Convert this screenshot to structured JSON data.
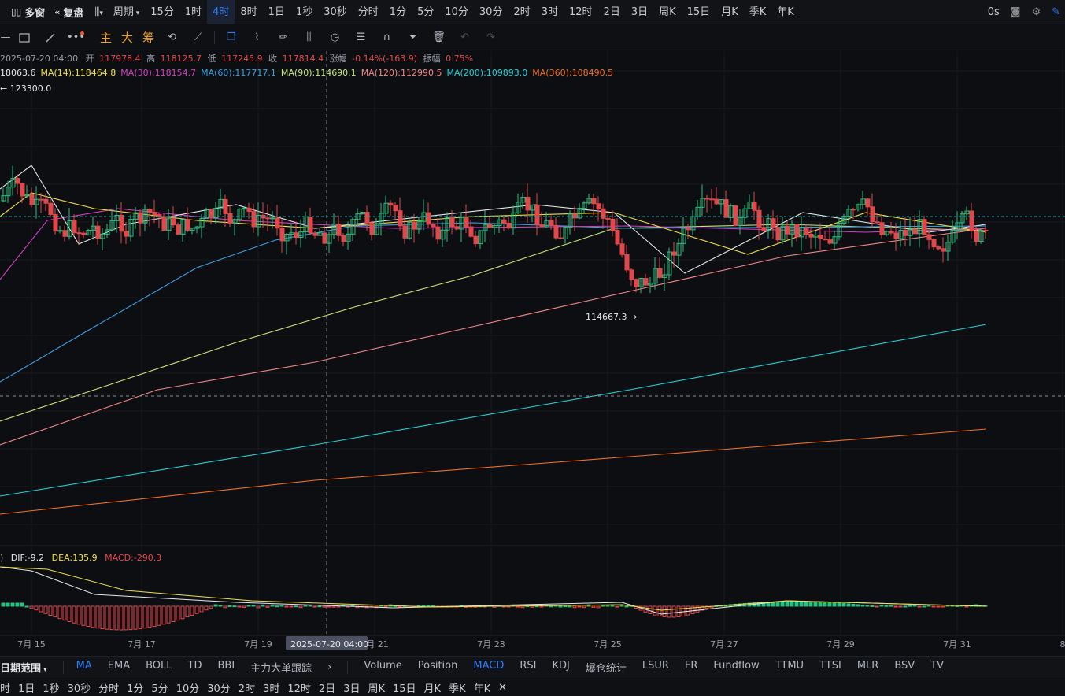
{
  "topbar": {
    "multi_window": "多窗",
    "restore": "复盘",
    "period_label": "周期",
    "intervals": [
      "15分",
      "1时",
      "4时",
      "8时",
      "1日",
      "1秒",
      "30秒",
      "分时",
      "1分",
      "5分",
      "10分",
      "30分",
      "2时",
      "3时",
      "12时",
      "2日",
      "3日",
      "周K",
      "15日",
      "月K",
      "季K",
      "年K"
    ],
    "active_interval": "4时",
    "latency": "0s"
  },
  "toolbar2": {
    "cn_tools": [
      "主",
      "大",
      "筹"
    ]
  },
  "info": {
    "date": "2025-07-20 04:00",
    "open_label": "开",
    "open": "117978.4",
    "high_label": "高",
    "high": "118125.7",
    "low_label": "低",
    "low": "117245.9",
    "close_label": "收",
    "close": "117814.4",
    "change_label": "涨幅",
    "change": "-0.14%(-163.9)",
    "amp_label": "振幅",
    "amp": "0.75%"
  },
  "ma": [
    {
      "label": "18063.6",
      "color": "#e8e8e8"
    },
    {
      "label": "MA(14):118464.8",
      "color": "#f0e040"
    },
    {
      "label": "MA(30):118154.7",
      "color": "#d040c0"
    },
    {
      "label": "MA(60):117717.1",
      "color": "#3aa0e0"
    },
    {
      "label": "MA(90):114690.1",
      "color": "#c8e878"
    },
    {
      "label": "MA(120):112990.5",
      "color": "#f08888"
    },
    {
      "label": "MA(200):109893.0",
      "color": "#20d0d8"
    },
    {
      "label": "MA(360):108490.5",
      "color": "#f07020"
    }
  ],
  "annotations": {
    "high_mark": "← 123300.0",
    "low_mark": "114667.3 →"
  },
  "macd": {
    "prefix": ")",
    "dif": "DIF:-9.2",
    "dea": "DEA:135.9",
    "macd": "MACD:-290.3"
  },
  "xaxis": {
    "labels": [
      "7月 15",
      "7月 17",
      "7月 19",
      "7月 21",
      "7月 23",
      "7月 25",
      "7月 27",
      "7月 29",
      "7月 31",
      "8"
    ],
    "crosshair_label": "2025-07-20 04:00"
  },
  "bottombar1": {
    "range": "日期范围",
    "main_indicators": [
      "MA",
      "EMA",
      "BOLL",
      "TD",
      "BBI",
      "主力大单跟踪"
    ],
    "active_main": "MA",
    "sub_indicators": [
      "Volume",
      "Position",
      "MACD",
      "RSI",
      "KDJ",
      "爆仓统计",
      "LSUR",
      "FR",
      "Fundflow",
      "TTMU",
      "TTSI",
      "MLR",
      "BSV",
      "TV"
    ],
    "active_sub": "MACD"
  },
  "bottombar2": {
    "items": [
      "时",
      "1日",
      "1秒",
      "30秒",
      "分时",
      "1分",
      "5分",
      "10分",
      "30分",
      "2时",
      "3时",
      "12时",
      "2日",
      "3日",
      "周K",
      "15日",
      "月K",
      "季K",
      "年K"
    ],
    "close": "✕"
  },
  "colors": {
    "up": "#26c281",
    "down": "#e2474b",
    "accent": "#2d7cf6"
  }
}
